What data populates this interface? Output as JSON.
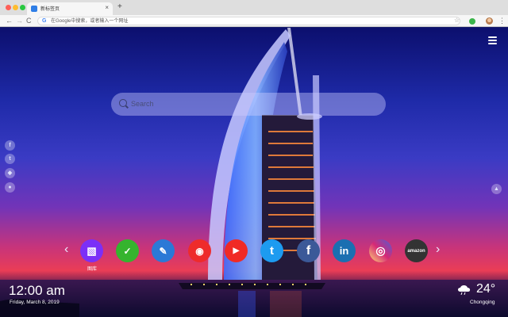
{
  "browser": {
    "tab_title": "新标签页",
    "tab_close": "×",
    "new_tab": "+",
    "omnibox_placeholder": "在Google中搜索，或者输入一个网址",
    "nav_back": "←",
    "nav_forward": "→",
    "nav_reload": "C",
    "bookmark_star": "☆",
    "menu_dots": "⋮"
  },
  "search": {
    "placeholder": "Search"
  },
  "social_sidebar": [
    {
      "icon": "facebook-icon",
      "glyph": "f"
    },
    {
      "icon": "twitter-icon",
      "glyph": "t"
    },
    {
      "icon": "snapchat-icon",
      "glyph": "◆"
    },
    {
      "icon": "wechat-icon",
      "glyph": "●"
    }
  ],
  "speed_dial": {
    "prev": "‹",
    "next": "›",
    "apps": [
      {
        "name": "gallery",
        "label": "图库",
        "color": "#7b2ff7",
        "glyph": "▧"
      },
      {
        "name": "tasks",
        "label": "",
        "color": "#35b42e",
        "glyph": "✓"
      },
      {
        "name": "notes",
        "label": "",
        "color": "#2b79d6",
        "glyph": "✎"
      },
      {
        "name": "games",
        "label": "",
        "color": "#ee2b2b",
        "glyph": "◉"
      },
      {
        "name": "youtube",
        "label": "",
        "color": "#f02a25",
        "glyph": "▶"
      },
      {
        "name": "twitter",
        "label": "",
        "color": "#1d9bf0",
        "glyph": "t"
      },
      {
        "name": "facebook",
        "label": "",
        "color": "#3b5998",
        "glyph": "f"
      },
      {
        "name": "linkedin",
        "label": "",
        "color": "#1b6fb1",
        "glyph": "in"
      },
      {
        "name": "instagram",
        "label": "",
        "color": "#d62976",
        "glyph": "◎"
      },
      {
        "name": "amazon",
        "label": "amazon",
        "color": "#333333",
        "glyph": ""
      }
    ]
  },
  "clock": {
    "time": "12:00 am",
    "date": "Friday, March 8, 2019"
  },
  "weather": {
    "temp": "24°",
    "city": "Chongqing",
    "icon": "cloud-rain-icon"
  }
}
